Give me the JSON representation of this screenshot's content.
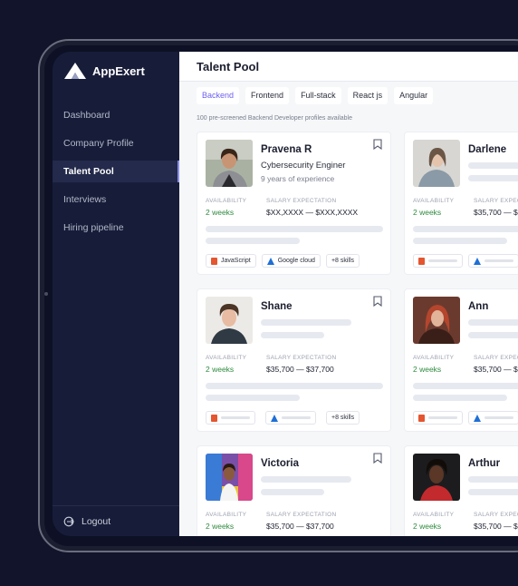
{
  "brand": {
    "name": "AppExert",
    "icon": "mountain-logo-icon"
  },
  "sidebar": {
    "items": [
      {
        "label": "Dashboard",
        "active": false
      },
      {
        "label": "Company Profile",
        "active": false
      },
      {
        "label": "Talent Pool",
        "active": true
      },
      {
        "label": "Interviews",
        "active": false
      },
      {
        "label": "Hiring pipeline",
        "active": false
      }
    ],
    "logout_label": "Logout"
  },
  "page": {
    "title": "Talent Pool",
    "filters": [
      "Backend",
      "Frontend",
      "Full-stack",
      "React js",
      "Angular"
    ],
    "active_filter": "Backend",
    "caption": "100 pre-screened Backend Developer profiles available"
  },
  "labels": {
    "availability": "AVAILABILITY",
    "salary": "SALARY EXPECTATION"
  },
  "candidates": [
    {
      "name": "Pravena R",
      "role": "Cybersecurity Enginer",
      "experience": "9 years of experience",
      "availability": "2 weeks",
      "salary": "$XX,XXXX — $XXX,XXXX",
      "tags": [
        "JavaScript",
        "Google cloud",
        "+8 skills"
      ]
    },
    {
      "name": "Darlene",
      "availability": "2 weeks",
      "salary": "$35,700 — $"
    },
    {
      "name": "Shane",
      "availability": "2 weeks",
      "salary": "$35,700 — $37,700",
      "more_skills": "+8 skills"
    },
    {
      "name": "Ann",
      "availability": "2 weeks",
      "salary": "$35,700 — $"
    },
    {
      "name": "Victoria",
      "availability": "2 weeks",
      "salary": "$35,700 — $37,700"
    },
    {
      "name": "Arthur",
      "availability": "2 weeks",
      "salary": "$35,700 — $"
    }
  ],
  "colors": {
    "accent": "#6d5ff0",
    "sidebar": "#171d39",
    "available": "#2e8a3e"
  }
}
